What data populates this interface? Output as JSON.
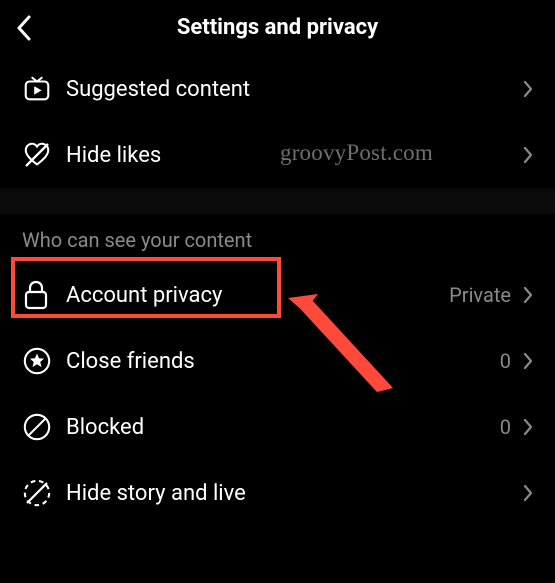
{
  "header": {
    "title": "Settings and privacy"
  },
  "section1": {
    "items": [
      {
        "label": "Suggested content",
        "icon": "suggested-content-icon"
      },
      {
        "label": "Hide likes",
        "icon": "hide-likes-icon"
      }
    ]
  },
  "section2": {
    "heading": "Who can see your content",
    "items": [
      {
        "label": "Account privacy",
        "value": "Private",
        "icon": "lock-icon",
        "highlighted": true
      },
      {
        "label": "Close friends",
        "value": "0",
        "icon": "star-circle-icon"
      },
      {
        "label": "Blocked",
        "value": "0",
        "icon": "blocked-icon"
      },
      {
        "label": "Hide story and live",
        "value": "",
        "icon": "hide-story-icon"
      }
    ]
  },
  "watermark": "groovyPost.com",
  "annotation": {
    "highlight_color": "#ff4a3a",
    "arrow_color": "#ff4a3a"
  }
}
